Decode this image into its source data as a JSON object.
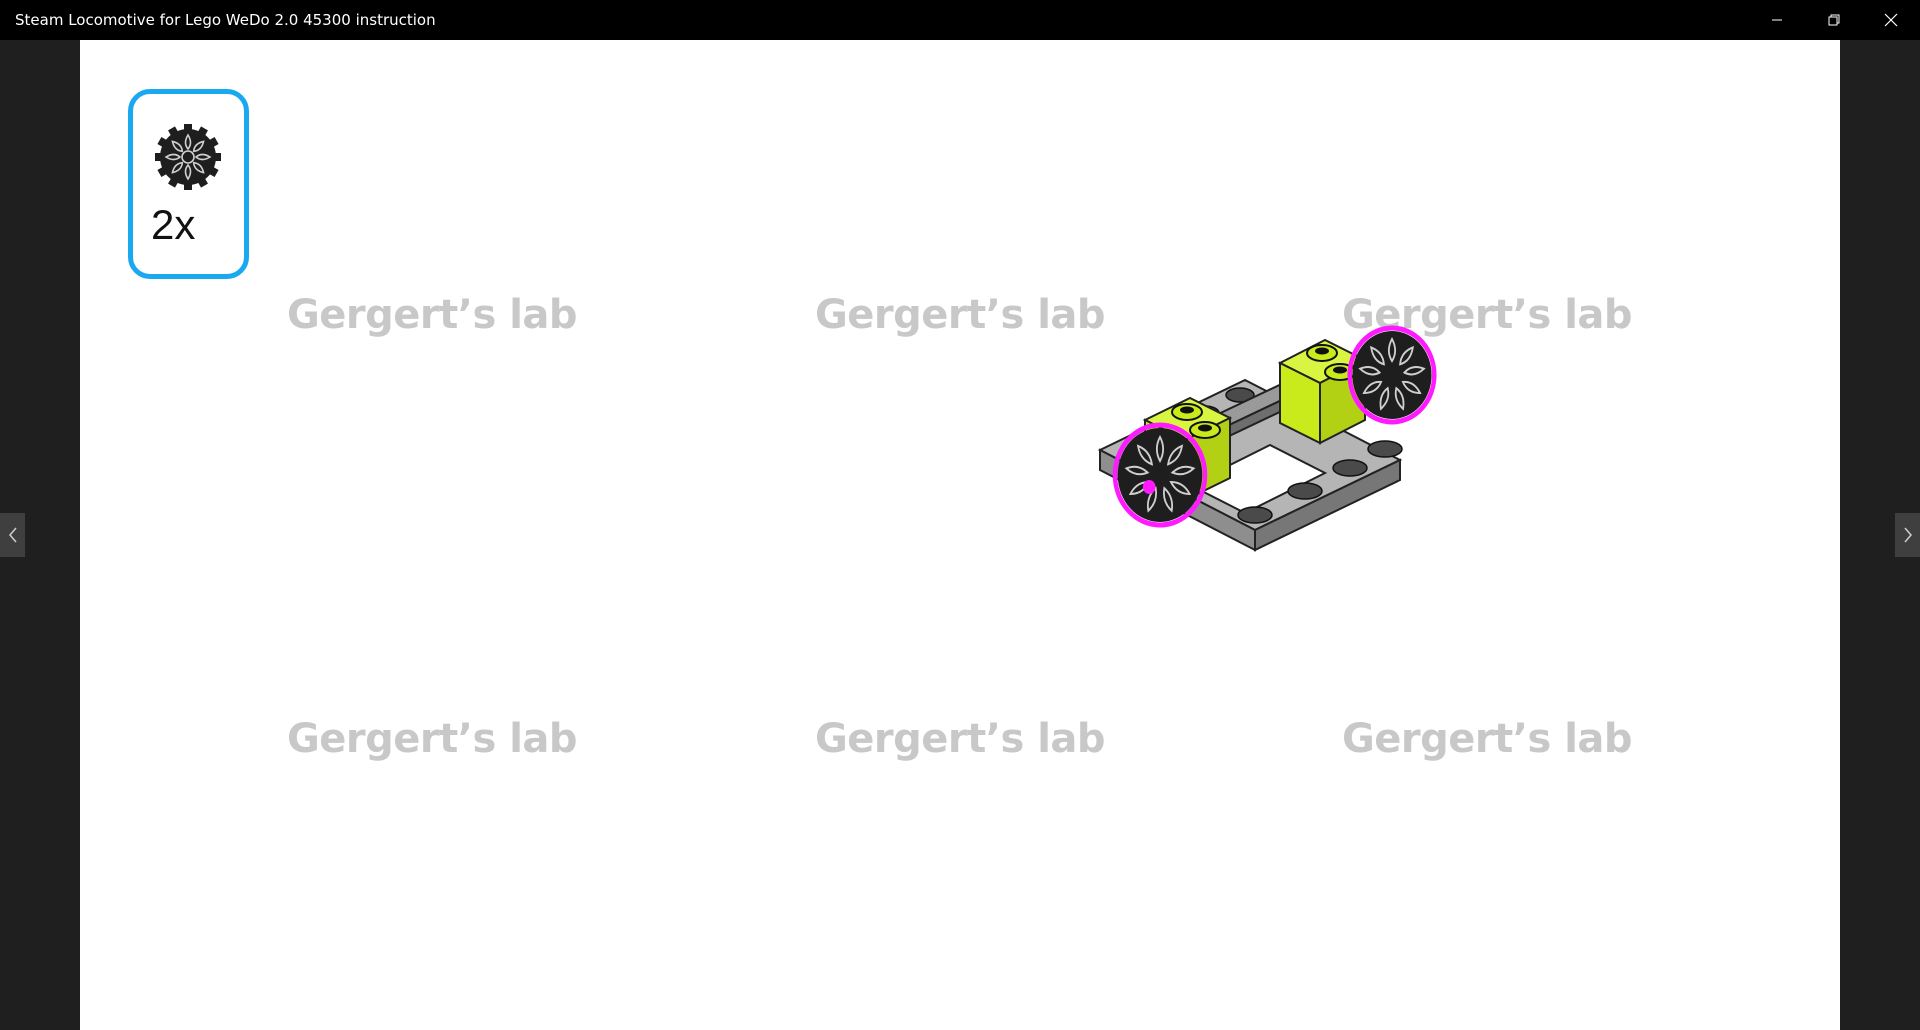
{
  "window": {
    "title": "Steam Locomotive for Lego WeDo 2.0 45300 instruction",
    "controls": {
      "minimize_icon": "minimize-icon",
      "maximize_icon": "restore-icon",
      "close_icon": "close-icon"
    }
  },
  "instruction_page": {
    "parts_callout": {
      "part_icon": "gear-wheel-icon",
      "quantity": "2x",
      "border_color": "#1aa9f0"
    },
    "watermarks": [
      "Gergert’s lab",
      "Gergert’s lab",
      "Gergert’s lab",
      "Gergert’s lab",
      "Gergert’s lab",
      "Gergert’s lab"
    ],
    "model": {
      "brick_color": "#c9eb1c",
      "plate_color": "#a0a0a0",
      "highlight_color": "#ff1aff"
    }
  },
  "navigation": {
    "prev_icon": "chevron-left-icon",
    "next_icon": "chevron-right-icon"
  }
}
